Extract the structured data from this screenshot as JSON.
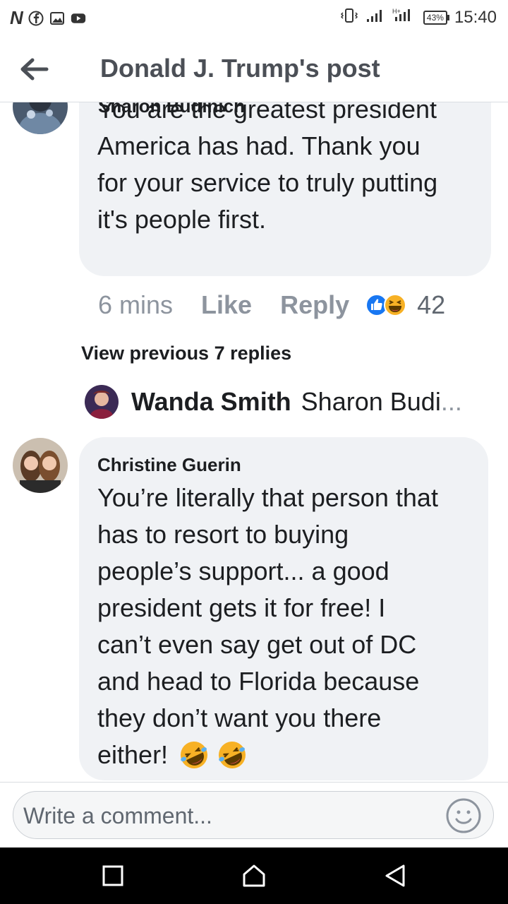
{
  "status_bar": {
    "time": "15:40",
    "battery": "43%",
    "left_icons": [
      "netflix-n-icon",
      "facebook-icon",
      "gallery-icon",
      "youtube-icon"
    ],
    "right_icons": [
      "vibrate-icon",
      "signal-icon",
      "signal-icon-2"
    ]
  },
  "header": {
    "title": "Donald J. Trump's post"
  },
  "comment1": {
    "author": "Sharon Budinich",
    "lines": [
      "You are the greatest president",
      "America has had.  Thank you",
      "for your service to truly putting",
      "it's people first."
    ],
    "time": "6 mins",
    "like_label": "Like",
    "reply_label": "Reply",
    "reaction_count": "42",
    "reactions": [
      "like",
      "haha"
    ]
  },
  "view_previous": "View previous 7 replies",
  "reply_preview": {
    "author": "Wanda Smith",
    "snippet": "Sharon Budi",
    "ellipsis": "..."
  },
  "comment2": {
    "author": "Christine Guerin",
    "lines": [
      "You’re literally that person that",
      "has to resort to buying",
      "people’s support...  a good",
      "president gets it for free!  I",
      "can’t even say get out of DC",
      "and head to Florida because",
      "they don’t want you there",
      "either!"
    ],
    "emojis": [
      "rolling-on-floor-laughing",
      "rolling-on-floor-laughing"
    ]
  },
  "composer": {
    "placeholder": "Write a comment..."
  },
  "colors": {
    "bubble": "#f0f2f5",
    "meta_text": "#8d949e",
    "like_blue": "#1877f2",
    "haha_yellow": "#f7b125"
  }
}
